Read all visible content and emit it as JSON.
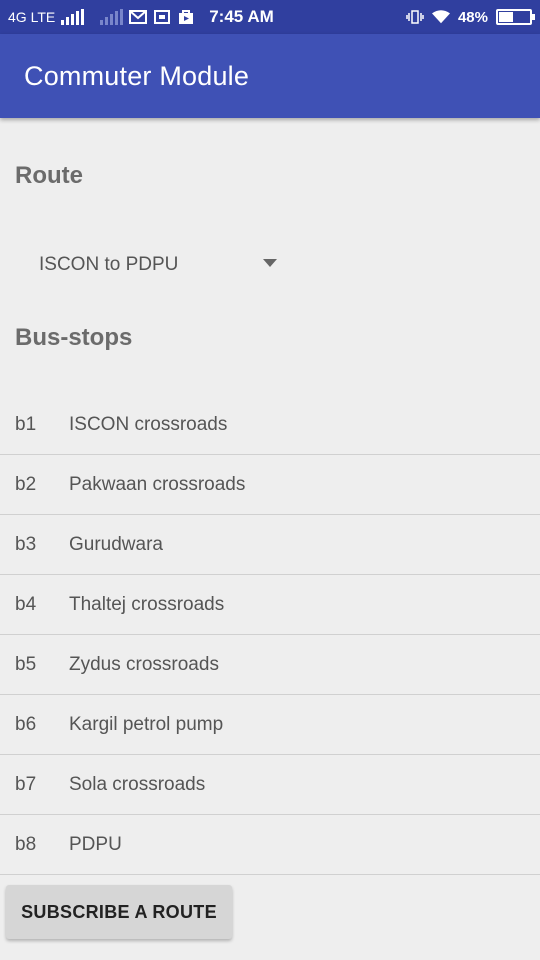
{
  "status_bar": {
    "network": "4G LTE",
    "time": "7:45 AM",
    "battery": "48%",
    "battery_level": 0.48,
    "icons": [
      "signal-icon",
      "signal-dim-icon",
      "mail-icon",
      "screenshot-icon",
      "play-store-icon",
      "vibrate-icon",
      "wifi-icon",
      "battery-icon"
    ]
  },
  "app_bar": {
    "title": "Commuter Module"
  },
  "route": {
    "heading": "Route",
    "selected": "ISCON to PDPU"
  },
  "bus_stops": {
    "heading": "Bus-stops",
    "items": [
      {
        "code": "b1",
        "name": "ISCON crossroads"
      },
      {
        "code": "b2",
        "name": "Pakwaan crossroads"
      },
      {
        "code": "b3",
        "name": "Gurudwara"
      },
      {
        "code": "b4",
        "name": "Thaltej crossroads"
      },
      {
        "code": "b5",
        "name": "Zydus crossroads"
      },
      {
        "code": "b6",
        "name": "Kargil petrol pump"
      },
      {
        "code": "b7",
        "name": "Sola crossroads"
      },
      {
        "code": "b8",
        "name": "PDPU"
      }
    ]
  },
  "subscribe_button": {
    "label": "SUBSCRIBE A ROUTE"
  },
  "colors": {
    "status_bar": "#303f9f",
    "app_bar": "#3f51b5",
    "background": "#eeeeee"
  }
}
